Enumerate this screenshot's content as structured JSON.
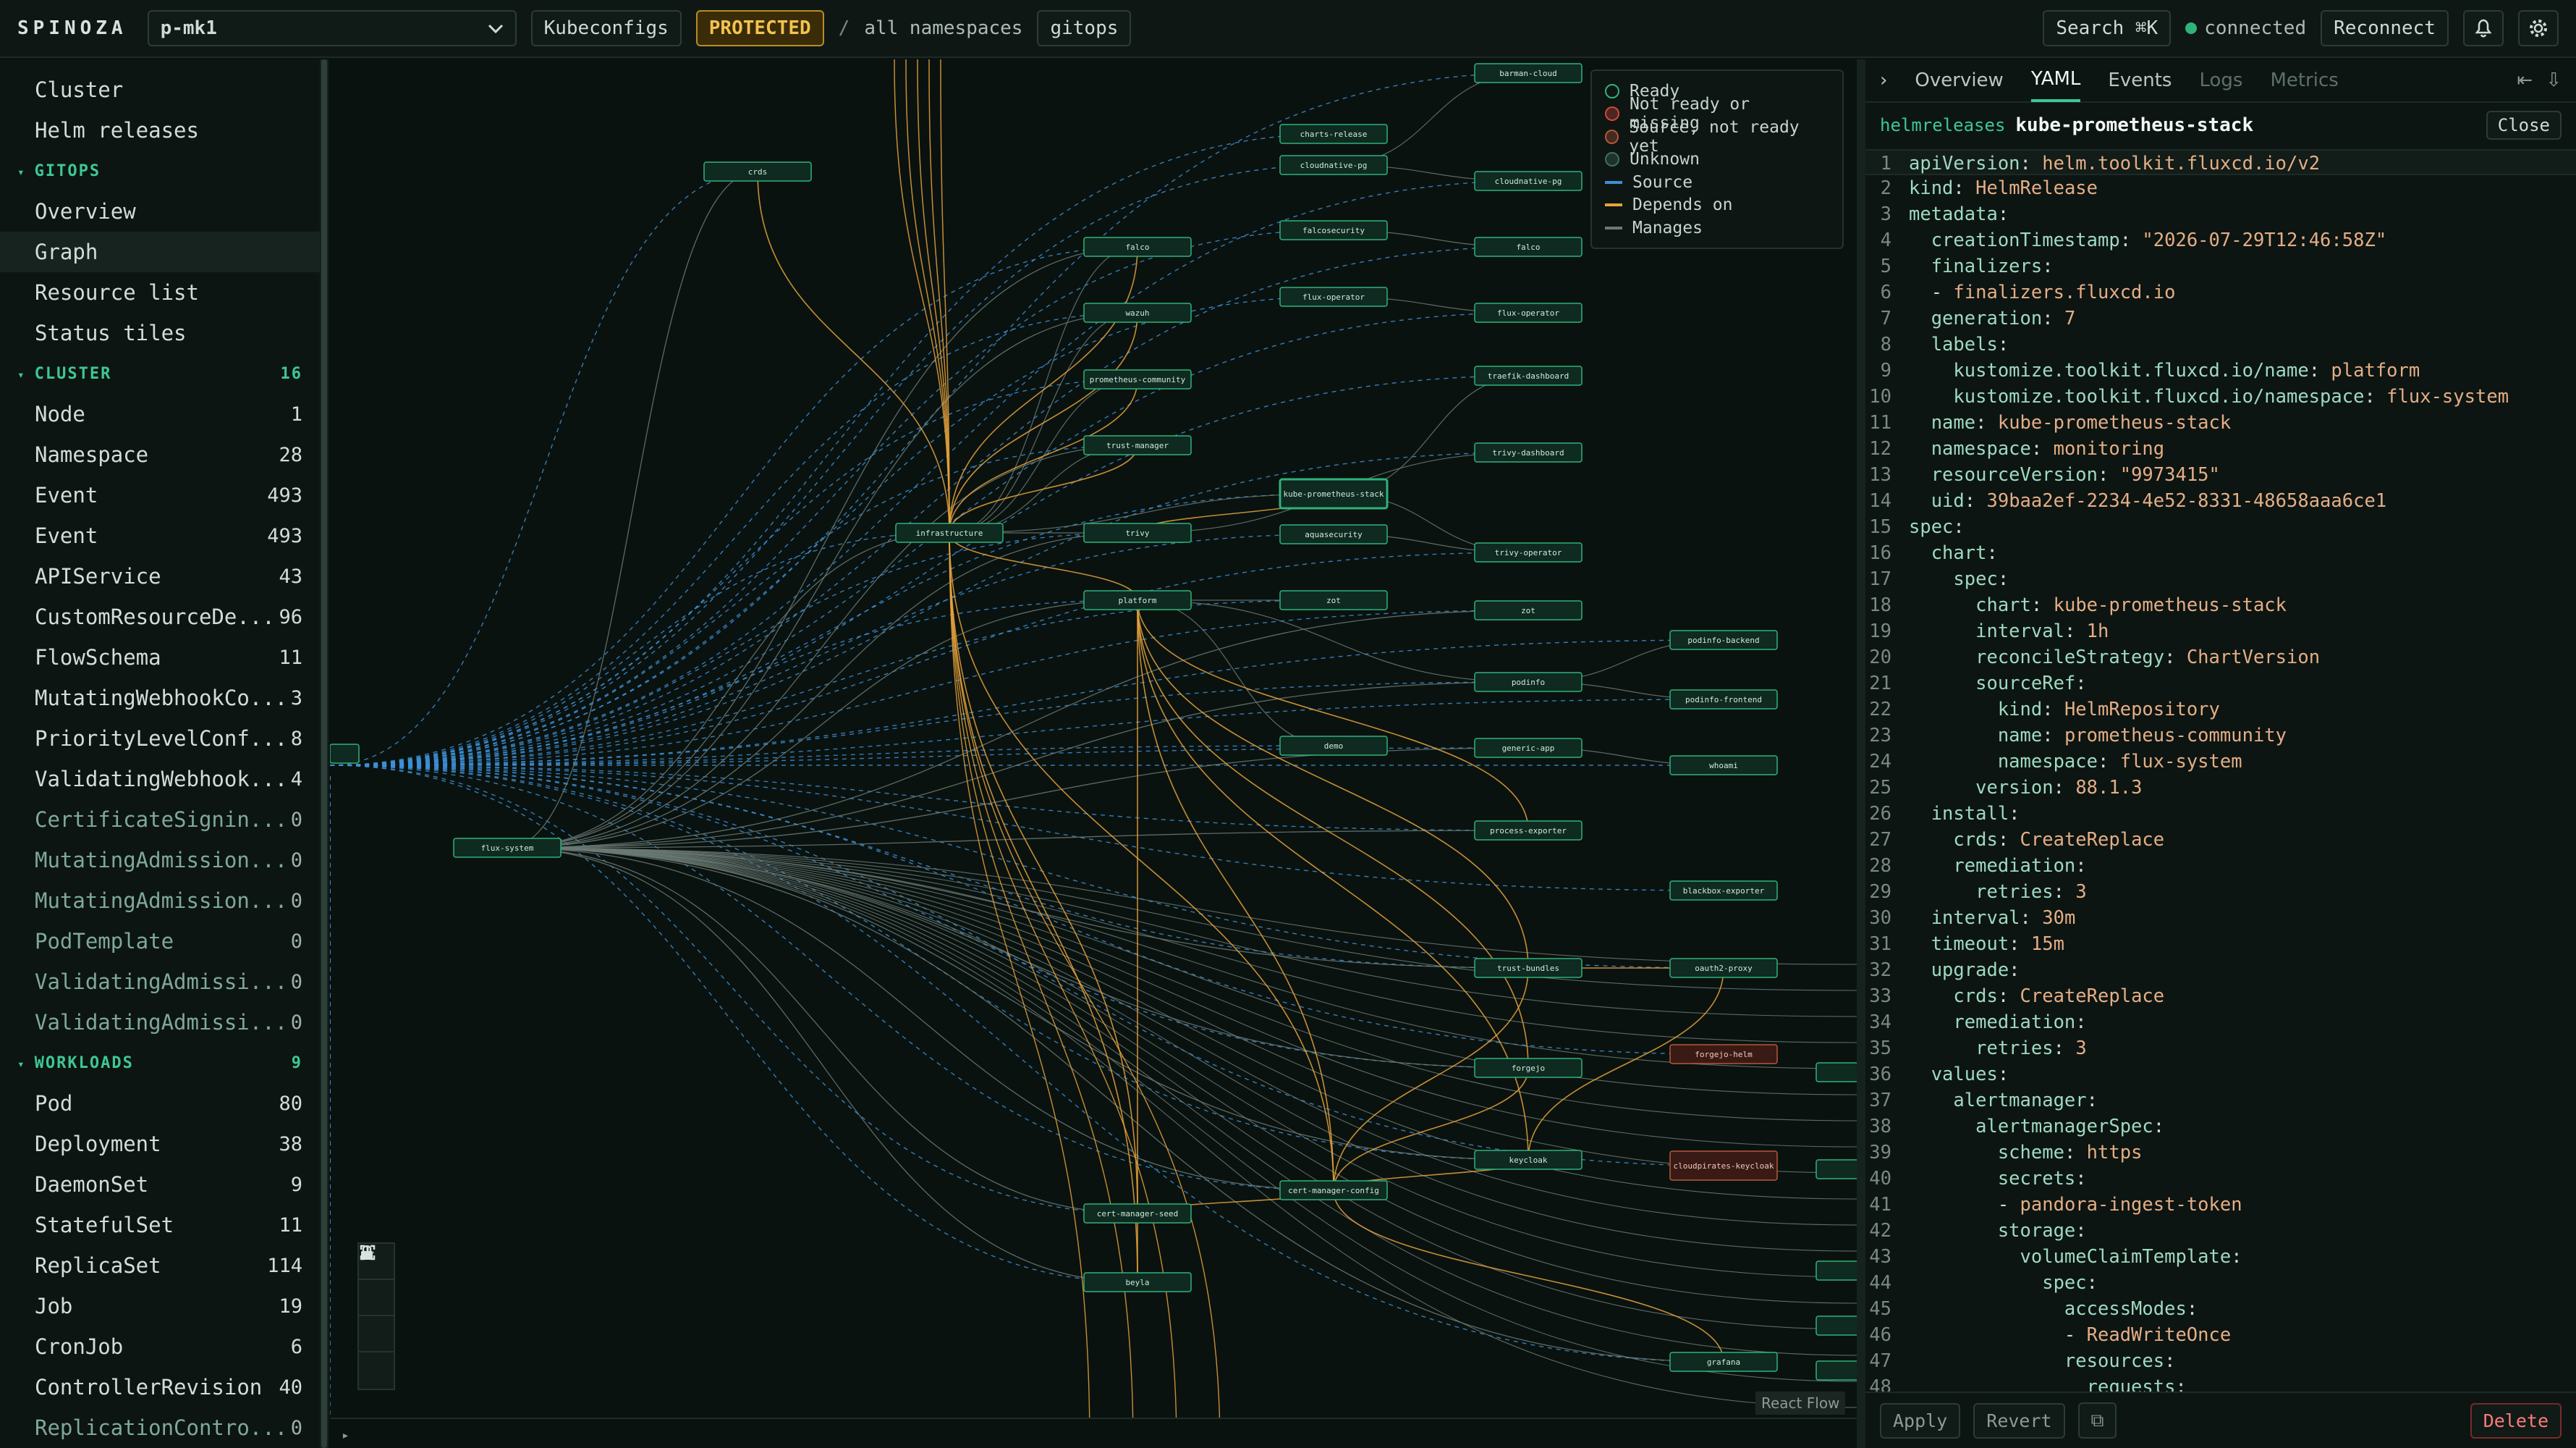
{
  "topbar": {
    "brand": "SPINOZA",
    "cluster_select": "p-mk1",
    "kubeconfigs": "Kubeconfigs",
    "protected": "PROTECTED",
    "crumb_sep": "/",
    "namespace": "all namespaces",
    "view": "gitops",
    "search": "Search ⌘K",
    "status": "connected",
    "reconnect": "Reconnect"
  },
  "sidebar": {
    "top": [
      "Cluster",
      "Helm releases"
    ],
    "gitops": {
      "title": "GITOPS",
      "items": [
        "Overview",
        "Graph",
        "Resource list",
        "Status tiles"
      ]
    },
    "cluster": {
      "title": "CLUSTER",
      "count": "16",
      "items": [
        {
          "label": "Node",
          "count": "1",
          "dim": false
        },
        {
          "label": "Namespace",
          "count": "28",
          "dim": false
        },
        {
          "label": "Event",
          "count": "493",
          "dim": false
        },
        {
          "label": "Event",
          "count": "493",
          "dim": false
        },
        {
          "label": "APIService",
          "count": "43",
          "dim": false
        },
        {
          "label": "CustomResourceDe...",
          "count": "96",
          "dim": false
        },
        {
          "label": "FlowSchema",
          "count": "11",
          "dim": false
        },
        {
          "label": "MutatingWebhookCo...",
          "count": "3",
          "dim": false
        },
        {
          "label": "PriorityLevelConf...",
          "count": "8",
          "dim": false
        },
        {
          "label": "ValidatingWebhook...",
          "count": "4",
          "dim": false
        },
        {
          "label": "CertificateSignin...",
          "count": "0",
          "dim": true
        },
        {
          "label": "MutatingAdmission...",
          "count": "0",
          "dim": true
        },
        {
          "label": "MutatingAdmission...",
          "count": "0",
          "dim": true
        },
        {
          "label": "PodTemplate",
          "count": "0",
          "dim": true
        },
        {
          "label": "ValidatingAdmissi...",
          "count": "0",
          "dim": true
        },
        {
          "label": "ValidatingAdmissi...",
          "count": "0",
          "dim": true
        }
      ]
    },
    "workloads": {
      "title": "WORKLOADS",
      "count": "9",
      "items": [
        {
          "label": "Pod",
          "count": "80",
          "dim": false
        },
        {
          "label": "Deployment",
          "count": "38",
          "dim": false
        },
        {
          "label": "DaemonSet",
          "count": "9",
          "dim": false
        },
        {
          "label": "StatefulSet",
          "count": "11",
          "dim": false
        },
        {
          "label": "ReplicaSet",
          "count": "114",
          "dim": false
        },
        {
          "label": "Job",
          "count": "19",
          "dim": false
        },
        {
          "label": "CronJob",
          "count": "6",
          "dim": false
        },
        {
          "label": "ControllerRevision",
          "count": "40",
          "dim": false
        },
        {
          "label": "ReplicationContro...",
          "count": "0",
          "dim": true
        }
      ]
    }
  },
  "graph": {
    "legend": [
      {
        "label": "Ready",
        "kind": "circle",
        "color": "#2fb27a"
      },
      {
        "label": "Not ready or missing",
        "kind": "circle",
        "color": "#d0483c"
      },
      {
        "label": "Source, not ready yet",
        "kind": "circle",
        "color": "#b5573a"
      },
      {
        "label": "Unknown",
        "kind": "circle",
        "color": "#3f6f5c"
      },
      {
        "label": "Source",
        "kind": "line",
        "color": "#3d8fd6"
      },
      {
        "label": "Depends on",
        "kind": "line",
        "color": "#e8a33b"
      },
      {
        "label": "Manages",
        "kind": "line",
        "color": "#6b7a74"
      }
    ],
    "nodes": [
      {
        "label": "crds",
        "state": "ready"
      },
      {
        "label": "barman-cloud",
        "state": "ready"
      },
      {
        "label": "charts-release",
        "state": "ready"
      },
      {
        "label": "cloudnative-pg",
        "state": "ready"
      },
      {
        "label": "cloudnative-pg",
        "state": "ready"
      },
      {
        "label": "falco",
        "state": "ready"
      },
      {
        "label": "falcosecurity",
        "state": "ready"
      },
      {
        "label": "falco",
        "state": "ready"
      },
      {
        "label": "wazuh",
        "state": "ready"
      },
      {
        "label": "flux-operator",
        "state": "ready"
      },
      {
        "label": "flux-operator",
        "state": "ready"
      },
      {
        "label": "prometheus-community",
        "state": "ready"
      },
      {
        "label": "traefik-dashboard",
        "state": "ready"
      },
      {
        "label": "trust-manager",
        "state": "ready"
      },
      {
        "label": "trivy-dashboard",
        "state": "ready"
      },
      {
        "label": "kube-prometheus-stack",
        "state": "ready"
      },
      {
        "label": "infrastructure",
        "state": "ready"
      },
      {
        "label": "trivy",
        "state": "ready"
      },
      {
        "label": "aquasecurity",
        "state": "ready"
      },
      {
        "label": "trivy-operator",
        "state": "ready"
      },
      {
        "label": "platform",
        "state": "ready"
      },
      {
        "label": "zot",
        "state": "ready"
      },
      {
        "label": "zot",
        "state": "ready"
      },
      {
        "label": "podinfo-backend",
        "state": "ready"
      },
      {
        "label": "podinfo",
        "state": "ready"
      },
      {
        "label": "podinfo-frontend",
        "state": "ready"
      },
      {
        "label": "demo",
        "state": "ready"
      },
      {
        "label": "generic-app",
        "state": "ready"
      },
      {
        "label": "whoami",
        "state": "ready"
      },
      {
        "label": "flux-system",
        "state": "ready"
      },
      {
        "label": "process-exporter",
        "state": "ready"
      },
      {
        "label": "blackbox-exporter",
        "state": "ready"
      },
      {
        "label": "trust-bundles",
        "state": "ready"
      },
      {
        "label": "oauth2-proxy",
        "state": "ready"
      },
      {
        "label": "forgejo",
        "state": "ready"
      },
      {
        "label": "forgejo-helm",
        "state": "notready"
      },
      {
        "label": "keycloak",
        "state": "ready"
      },
      {
        "label": "cloudpirates-keycloak",
        "state": "notready"
      },
      {
        "label": "cert-manager-config",
        "state": "ready"
      },
      {
        "label": "cert-manager-seed",
        "state": "ready"
      },
      {
        "label": "beyla",
        "state": "ready"
      },
      {
        "label": "grafana",
        "state": "ready"
      }
    ],
    "attribution": "React Flow",
    "footer_caret": "▸"
  },
  "panel": {
    "tabs": [
      "Overview",
      "YAML",
      "Events",
      "Logs",
      "Metrics"
    ],
    "active_tab": "YAML",
    "kind": "helmreleases",
    "name": "kube-prometheus-stack",
    "close": "Close",
    "yaml": [
      [
        "apiVersion",
        "helm.toolkit.fluxcd.io/v2"
      ],
      [
        "kind",
        "HelmRelease"
      ],
      [
        "metadata",
        ""
      ],
      [
        "  creationTimestamp",
        "\"2026-07-29T12:46:58Z\""
      ],
      [
        "  finalizers",
        ""
      ],
      [
        "  - ",
        "finalizers.fluxcd.io"
      ],
      [
        "  generation",
        "7"
      ],
      [
        "  labels",
        ""
      ],
      [
        "    kustomize.toolkit.fluxcd.io/name",
        "platform"
      ],
      [
        "    kustomize.toolkit.fluxcd.io/namespace",
        "flux-system"
      ],
      [
        "  name",
        "kube-prometheus-stack"
      ],
      [
        "  namespace",
        "monitoring"
      ],
      [
        "  resourceVersion",
        "\"9973415\""
      ],
      [
        "  uid",
        "39baa2ef-2234-4e52-8331-48658aaa6ce1"
      ],
      [
        "spec",
        ""
      ],
      [
        "  chart",
        ""
      ],
      [
        "    spec",
        ""
      ],
      [
        "      chart",
        "kube-prometheus-stack"
      ],
      [
        "      interval",
        "1h"
      ],
      [
        "      reconcileStrategy",
        "ChartVersion"
      ],
      [
        "      sourceRef",
        ""
      ],
      [
        "        kind",
        "HelmRepository"
      ],
      [
        "        name",
        "prometheus-community"
      ],
      [
        "        namespace",
        "flux-system"
      ],
      [
        "      version",
        "88.1.3"
      ],
      [
        "  install",
        ""
      ],
      [
        "    crds",
        "CreateReplace"
      ],
      [
        "    remediation",
        ""
      ],
      [
        "      retries",
        "3"
      ],
      [
        "  interval",
        "30m"
      ],
      [
        "  timeout",
        "15m"
      ],
      [
        "  upgrade",
        ""
      ],
      [
        "    crds",
        "CreateReplace"
      ],
      [
        "    remediation",
        ""
      ],
      [
        "      retries",
        "3"
      ],
      [
        "  values",
        ""
      ],
      [
        "    alertmanager",
        ""
      ],
      [
        "      alertmanagerSpec",
        ""
      ],
      [
        "        scheme",
        "https"
      ],
      [
        "        secrets",
        ""
      ],
      [
        "        - ",
        "pandora-ingest-token"
      ],
      [
        "        storage",
        ""
      ],
      [
        "          volumeClaimTemplate",
        ""
      ],
      [
        "            spec",
        ""
      ],
      [
        "              accessModes",
        ""
      ],
      [
        "              - ",
        "ReadWriteOnce"
      ],
      [
        "              resources",
        ""
      ],
      [
        "                requests",
        ""
      ]
    ],
    "footer": {
      "apply": "Apply",
      "revert": "Revert",
      "delete": "Delete"
    }
  },
  "colors": {
    "accent": "#3ec794",
    "ready": "#2fb27a",
    "notready": "#d0483c",
    "source_edge": "#3d8fd6",
    "depends_edge": "#e8a33b",
    "manages_edge": "#6b7a74"
  }
}
